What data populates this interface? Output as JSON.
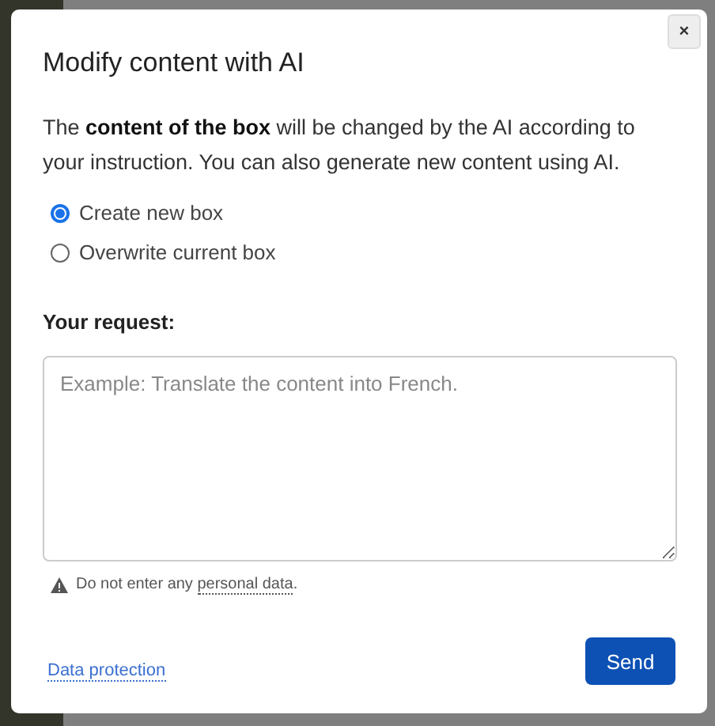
{
  "dialog": {
    "title": "Modify content with AI",
    "close": "×",
    "description": "The **content of the box** will be changed by the AI according to your instruction. You can also generate new content using AI.",
    "options": [
      {
        "label": "Create new box",
        "selected": true
      },
      {
        "label": "Overwrite current box",
        "selected": false
      }
    ],
    "request_label": "Your request:",
    "request_field": {
      "placeholder": "Example: Translate the content into French."
    },
    "notice": {
      "text": "Do not enter any ",
      "link": "personal data",
      "end": "."
    },
    "footer_link": "Data protection",
    "send_button": "Send"
  }
}
